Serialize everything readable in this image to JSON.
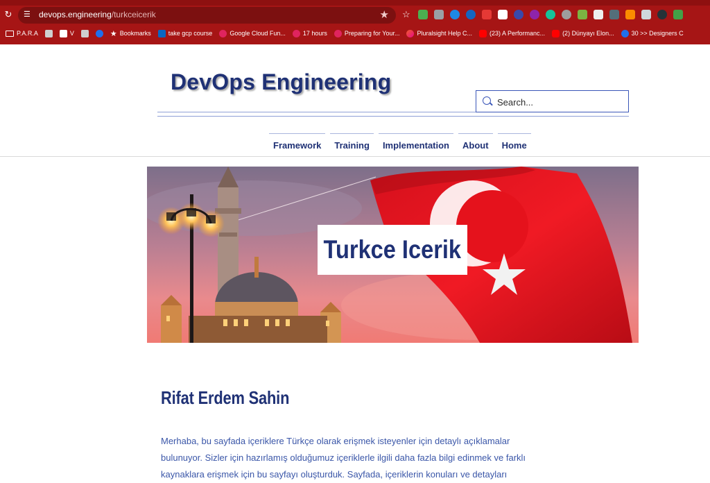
{
  "browser": {
    "url_host": "devops.engineering",
    "url_path": "/turkceicerik",
    "colors": {
      "chrome": "#a61515"
    },
    "bookmarks": [
      {
        "label": "P.A.R.A",
        "icon": "folder-icon"
      },
      {
        "label": "",
        "icon": "app-icon"
      },
      {
        "label": "V",
        "icon": "checklist-icon"
      },
      {
        "label": "",
        "icon": "app-icon"
      },
      {
        "label": "",
        "icon": "chrome-icon"
      },
      {
        "label": "Bookmarks",
        "icon": "star-icon"
      },
      {
        "label": "take gcp course",
        "icon": "linkedin-icon"
      },
      {
        "label": "Google Cloud Fun...",
        "icon": "app-icon"
      },
      {
        "label": "17 hours",
        "icon": "app-icon"
      },
      {
        "label": "Preparing for Your...",
        "icon": "app-icon"
      },
      {
        "label": "Pluralsight Help C...",
        "icon": "pluralsight-icon"
      },
      {
        "label": "(23) A Performanc...",
        "icon": "youtube-icon"
      },
      {
        "label": "(2) Dünyayı Elon...",
        "icon": "youtube-icon"
      },
      {
        "label": "30 >> Designers C",
        "icon": "globe-icon"
      }
    ]
  },
  "site": {
    "title": "DevOps Engineering",
    "search_placeholder": "Search...",
    "nav": [
      "Framework",
      "Training",
      "Implementation",
      "About",
      "Home"
    ],
    "colors": {
      "primary": "#1f3175",
      "link": "#3a56a8"
    }
  },
  "hero": {
    "title": "Turkce Icerik"
  },
  "content": {
    "author": "Rifat Erdem Sahin",
    "paragraph": "Merhaba, bu sayfada içeriklere Türkçe olarak erişmek isteyenler için detaylı açıklamalar bulunuyor. Sizler için hazırlamış olduğumuz içeriklerle ilgili daha fazla bilgi edinmek ve farklı kaynaklara erişmek için bu sayfayı oluşturduk. Sayfada, içeriklerin konuları ve detayları hakkında"
  }
}
